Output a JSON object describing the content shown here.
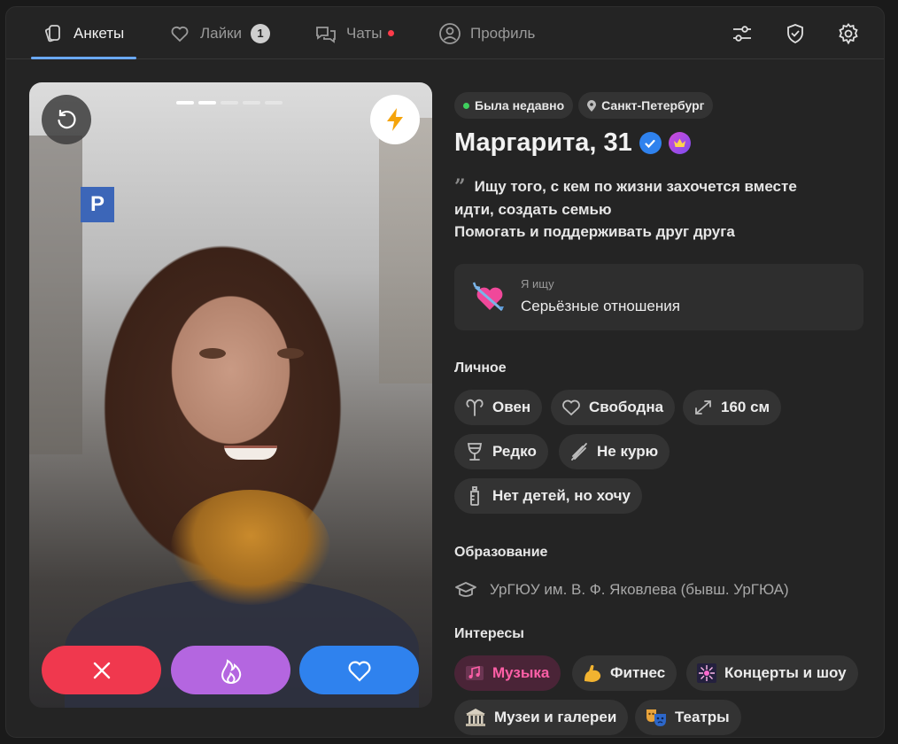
{
  "nav": {
    "tabs": [
      {
        "label": "Анкеты",
        "icon": "cards-icon",
        "active": true
      },
      {
        "label": "Лайки",
        "icon": "heart-icon",
        "badge": "1"
      },
      {
        "label": "Чаты",
        "icon": "chat-icon",
        "dot": true
      },
      {
        "label": "Профиль",
        "icon": "user-circle-icon"
      }
    ],
    "tools": [
      "filters-icon",
      "shield-check-icon",
      "gear-icon"
    ]
  },
  "photo": {
    "pages_total": 5,
    "pages_active": [
      1,
      2
    ],
    "buttons": [
      "rewind-icon",
      "lightning-icon",
      "close-icon",
      "fire-icon",
      "heart-icon"
    ]
  },
  "profile": {
    "status": "Была недавно",
    "city": "Санкт-Петербург",
    "name_age": "Маргарита, 31",
    "quote_line1": "Ищу того, с кем по жизни захочется вместе",
    "quote_line2": "идти, создать семью",
    "quote_line3": "Помогать и поддерживать друг друга",
    "seeking_label": "Я ищу",
    "seeking_value": "Серьёзные отношения",
    "personal_title": "Личное",
    "personal": {
      "zodiac": "Овен",
      "relationship": "Свободна",
      "height": "160 см",
      "alcohol": "Редко",
      "smoking": "Не курю",
      "kids": "Нет детей, но хочу"
    },
    "education_title": "Образование",
    "education": "УрГЮУ им. В. Ф. Яковлева (бывш. УрГЮА)",
    "interests_title": "Интересы",
    "interests": {
      "music": "Музыка",
      "fitness": "Фитнес",
      "concerts": "Концерты и шоу",
      "museums": "Музеи и галереи",
      "theatres": "Театры"
    }
  },
  "colors": {
    "accent": "#2f82ee",
    "dislike": "#f0384e",
    "superlike": "#b466e0",
    "online": "#3fcf5e",
    "music_highlight": "#ff5fa7"
  }
}
